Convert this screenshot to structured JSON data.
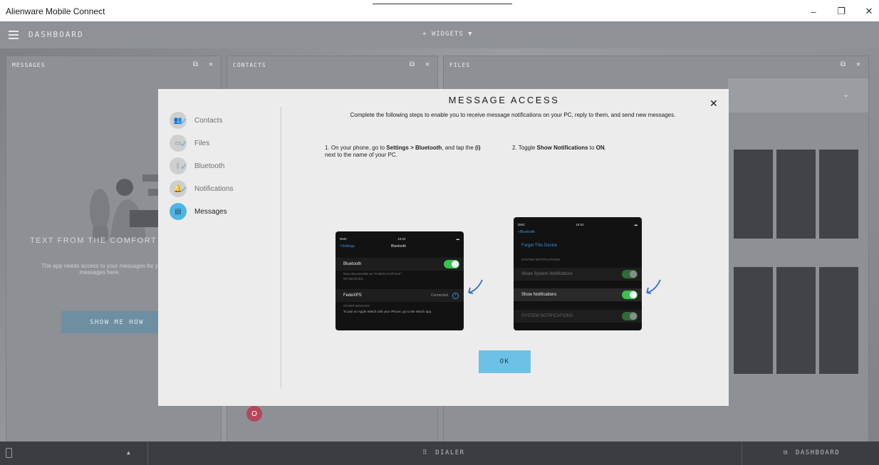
{
  "window": {
    "title": "Alienware Mobile Connect",
    "minimize": "–",
    "maximize": "❐",
    "close": "✕"
  },
  "dashboard": {
    "title": "DASHBOARD",
    "widgets_label": "+ WIDGETS ▼",
    "panels": {
      "messages": {
        "title": "MESSAGES",
        "headline": "TEXT FROM THE COMFORT OF Y",
        "description": "The app needs access to your messages for y messages here.",
        "button": "SHOW ME HOW"
      },
      "contacts": {
        "title": "CONTACTS",
        "contact_initial": "O"
      },
      "files": {
        "title": "FILES"
      }
    },
    "panel_icons": {
      "popout": "⧉",
      "close": "✕"
    }
  },
  "bottombar": {
    "dialer": "DIALER",
    "dashboard": "DASHBOARD",
    "caret": "▲"
  },
  "modal": {
    "title": "MESSAGE ACCESS",
    "subtitle": "Complete the following steps to enable you to receive message notifications on your PC, reply to them, and send new messages.",
    "close": "✕",
    "nav": [
      {
        "label": "Contacts",
        "icon": "contacts-icon",
        "glyph": "👥",
        "done": true
      },
      {
        "label": "Files",
        "icon": "folder-icon",
        "glyph": "▭",
        "done": true
      },
      {
        "label": "Bluetooth",
        "icon": "bluetooth-icon",
        "glyph": "ᛒ",
        "done": true
      },
      {
        "label": "Notifications",
        "icon": "bell-icon",
        "glyph": "🔔",
        "done": true
      },
      {
        "label": "Messages",
        "icon": "message-icon",
        "glyph": "▤",
        "done": false
      }
    ],
    "check_glyph": "✓",
    "step1": {
      "prefix": "1. On your phone, go to ",
      "bold1": "Settings > Bluetooth",
      "middle": ", and tap the ",
      "bold2": "(i)",
      "suffix": " next to the name of your PC."
    },
    "step2": {
      "prefix": "2. Toggle ",
      "bold1": "Show Notifications",
      "middle": " to ",
      "bold2": "ON",
      "suffix": "."
    },
    "phone1": {
      "carrier": "DMC",
      "time": "15:02",
      "back": "<Settings",
      "header": "Bluetooth",
      "bluetooth_label": "Bluetooth",
      "discoverable": "Now discoverable as \"Federico's iPhone\".",
      "my_devices": "MY DEVICES",
      "device_name": "FedeXPS",
      "device_status": "Connected",
      "info": "i",
      "other_devices": "OTHER DEVICES",
      "watch_note": "To pair an Apple Watch with your iPhone, go to the Watch app."
    },
    "phone2": {
      "carrier": "DMC",
      "time": "15:02",
      "back": "<Bluetooth",
      "forget": "Forget This Device",
      "section1": "SYSTEM NOTIFICATIONS",
      "share": "Share System Notifications",
      "show": "Show Notifications",
      "section2": "SYSTEM NOTIFICATIONS"
    },
    "ok": "OK"
  },
  "colors": {
    "accent": "#4fb5e6",
    "ok_button": "#6cc2e6",
    "toggle_on": "#38c24e"
  }
}
